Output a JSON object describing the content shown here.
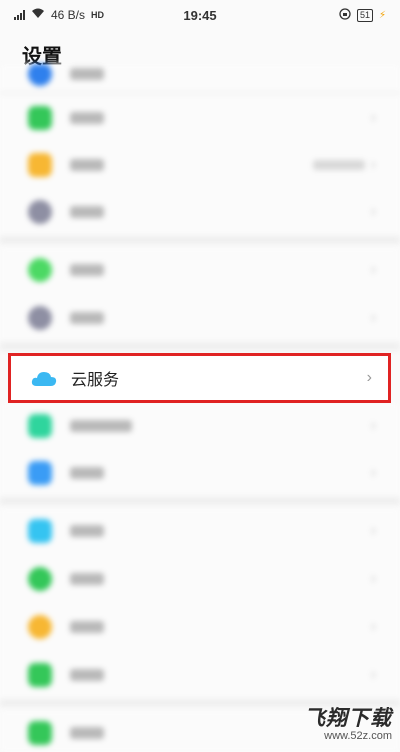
{
  "status_bar": {
    "network": "46 B/s",
    "hd": "HD",
    "time": "19:45",
    "battery": "51"
  },
  "header": {
    "title": "设置"
  },
  "highlighted_item": {
    "label": "云服务",
    "icon": "cloud-icon"
  },
  "blurred_icon_colors": [
    "#2f80ed",
    "#34c759",
    "#f7b733",
    "#8e8fa3",
    "#4cd964",
    "#8e8fa3",
    "#2fd59d",
    "#3a9cf5",
    "#35c4f1",
    "#34c759",
    "#f7b733",
    "#34c759",
    "#34c759"
  ],
  "watermark": {
    "name": "飞翔下载",
    "site": "www.52z.com"
  }
}
